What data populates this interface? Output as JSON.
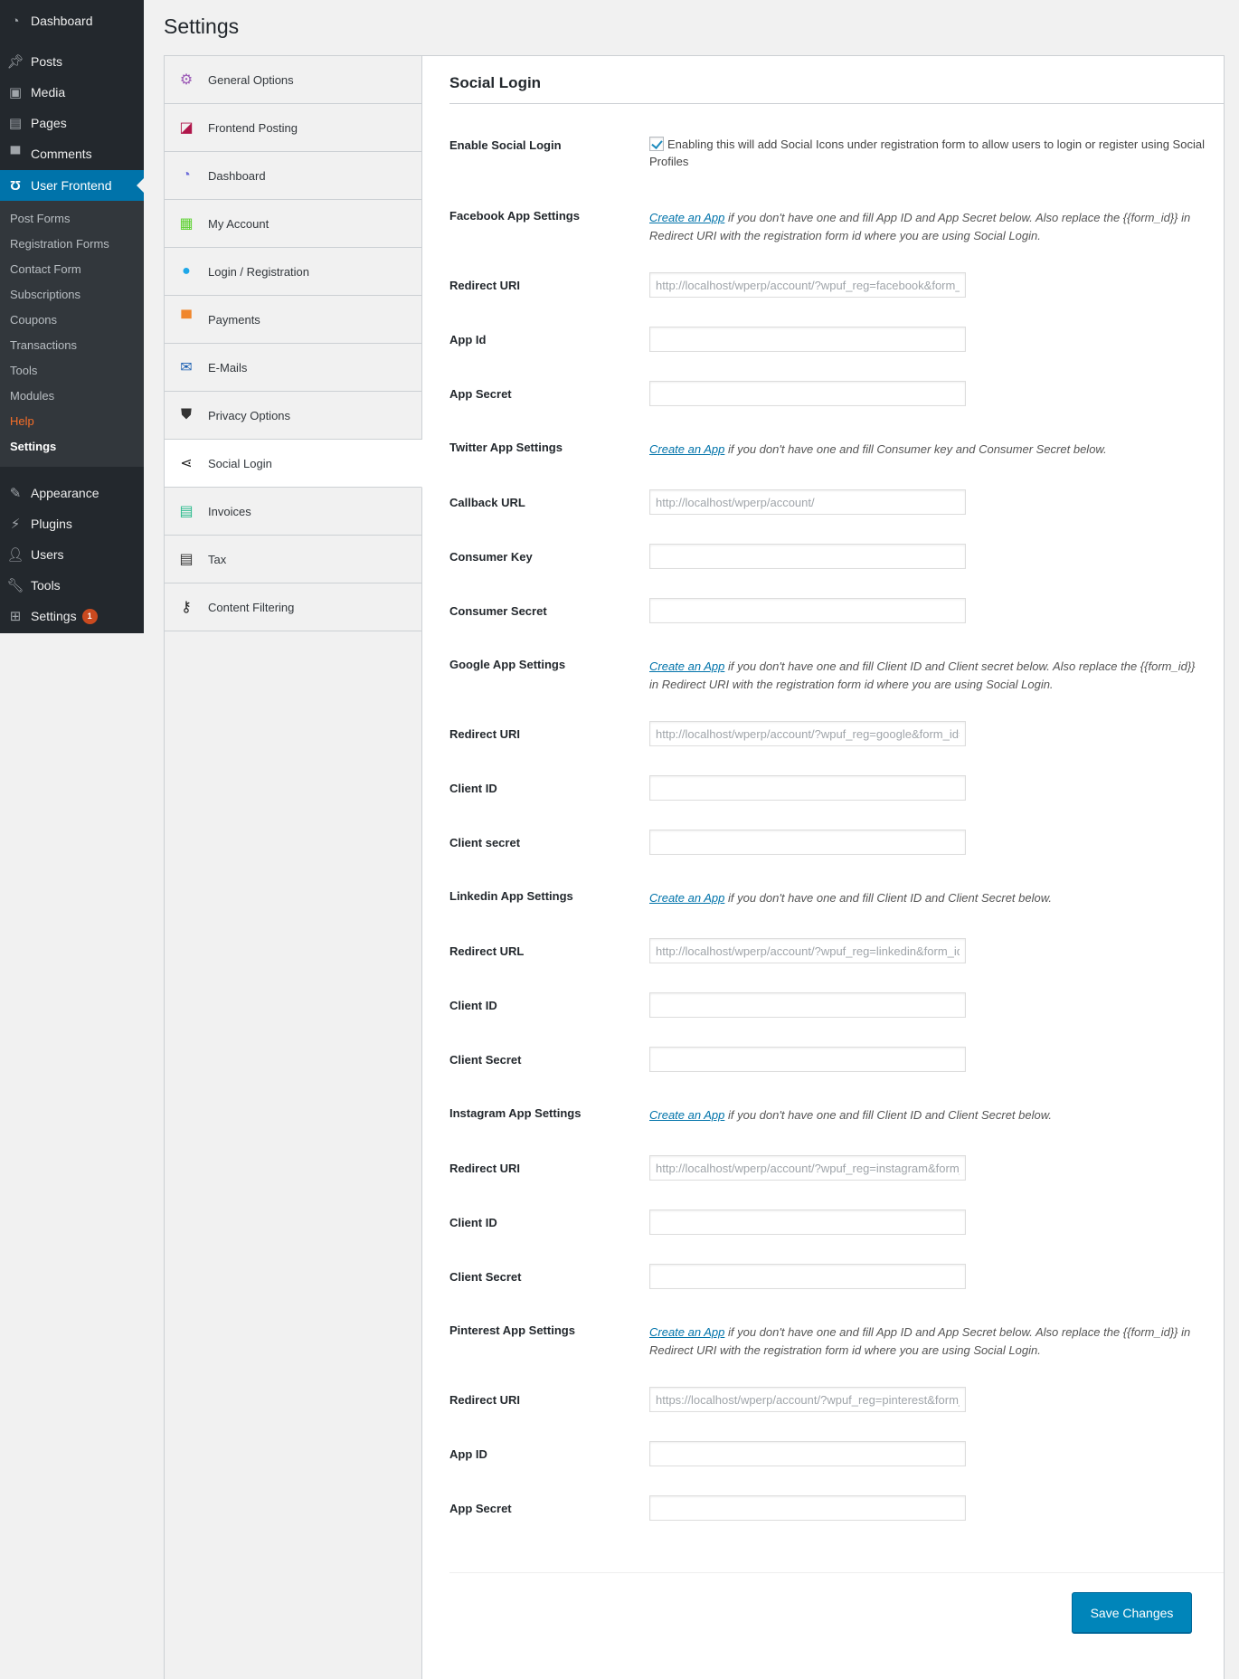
{
  "admin_menu": {
    "items_top": [
      {
        "label": "Dashboard",
        "icon": "dashboard-icon"
      }
    ],
    "items_content": [
      {
        "label": "Posts",
        "icon": "pin-icon"
      },
      {
        "label": "Media",
        "icon": "media-icon"
      },
      {
        "label": "Pages",
        "icon": "pages-icon"
      },
      {
        "label": "Comments",
        "icon": "comment-icon"
      }
    ],
    "current": {
      "label": "User Frontend",
      "icon": "user-frontend-icon"
    },
    "submenu": [
      "Post Forms",
      "Registration Forms",
      "Contact Form",
      "Subscriptions",
      "Coupons",
      "Transactions",
      "Tools",
      "Modules",
      "Help",
      "Settings"
    ],
    "items_bottom": [
      {
        "label": "Appearance",
        "icon": "paintbrush-icon"
      },
      {
        "label": "Plugins",
        "icon": "plugin-icon"
      },
      {
        "label": "Users",
        "icon": "users-icon"
      },
      {
        "label": "Tools",
        "icon": "wrench-icon"
      },
      {
        "label": "Settings",
        "icon": "settings-icon",
        "badge": "1"
      }
    ]
  },
  "page": {
    "title": "Settings"
  },
  "tabs": [
    {
      "label": "General Options",
      "icon": "gear-icon",
      "color": "#9b59b6"
    },
    {
      "label": "Frontend Posting",
      "icon": "edit-icon",
      "color": "#b0154a"
    },
    {
      "label": "Dashboard",
      "icon": "dashboard-icon",
      "color": "#6c6cd9"
    },
    {
      "label": "My Account",
      "icon": "id-card-icon",
      "color": "#5bd12e"
    },
    {
      "label": "Login / Registration",
      "icon": "user-icon",
      "color": "#1ea7e8"
    },
    {
      "label": "Payments",
      "icon": "payment-icon",
      "color": "#f0862b"
    },
    {
      "label": "E-Mails",
      "icon": "envelope-icon",
      "color": "#1b5fb2"
    },
    {
      "label": "Privacy Options",
      "icon": "shield-icon",
      "color": "#333333"
    },
    {
      "label": "Social Login",
      "icon": "share-icon",
      "color": "#222222",
      "active": true
    },
    {
      "label": "Invoices",
      "icon": "invoice-icon",
      "color": "#26b98a"
    },
    {
      "label": "Tax",
      "icon": "document-icon",
      "color": "#333333"
    },
    {
      "label": "Content Filtering",
      "icon": "key-icon",
      "color": "#222222"
    }
  ],
  "panel": {
    "title": "Social Login",
    "enable": {
      "label": "Enable Social Login",
      "checked": true,
      "text": "Enabling this will add Social Icons under registration form to allow users to login or register using Social Profiles"
    },
    "link_text": "Create an App",
    "sections": [
      {
        "heading": "Facebook App Settings",
        "desc": "if you don't have one and fill App ID and App Secret below. Also replace the {{form_id}} in Redirect URI with the registration form id where you are using Social Login.",
        "fields": [
          {
            "label": "Redirect URI",
            "value": "http://localhost/wperp/account/?wpuf_reg=facebook&form_id={{form_id}}",
            "readonly": true
          },
          {
            "label": "App Id",
            "value": ""
          },
          {
            "label": "App Secret",
            "value": ""
          }
        ]
      },
      {
        "heading": "Twitter App Settings",
        "desc": "if you don't have one and fill Consumer key and Consumer Secret below.",
        "fields": [
          {
            "label": "Callback URL",
            "value": "http://localhost/wperp/account/",
            "readonly": true
          },
          {
            "label": "Consumer Key",
            "value": ""
          },
          {
            "label": "Consumer Secret",
            "value": ""
          }
        ]
      },
      {
        "heading": "Google App Settings",
        "desc": "if you don't have one and fill Client ID and Client secret below. Also replace the {{form_id}} in Redirect URI with the registration form id where you are using Social Login.",
        "fields": [
          {
            "label": "Redirect URI",
            "value": "http://localhost/wperp/account/?wpuf_reg=google&form_id={{form_id}}",
            "readonly": true
          },
          {
            "label": "Client ID",
            "value": ""
          },
          {
            "label": "Client secret",
            "value": ""
          }
        ]
      },
      {
        "heading": "Linkedin App Settings",
        "desc": "if you don't have one and fill Client ID and Client Secret below.",
        "fields": [
          {
            "label": "Redirect URL",
            "value": "http://localhost/wperp/account/?wpuf_reg=linkedin&form_id={{form_id}}",
            "readonly": true
          },
          {
            "label": "Client ID",
            "value": ""
          },
          {
            "label": "Client Secret",
            "value": ""
          }
        ]
      },
      {
        "heading": "Instagram App Settings",
        "desc": "if you don't have one and fill Client ID and Client Secret below.",
        "fields": [
          {
            "label": "Redirect URI",
            "value": "http://localhost/wperp/account/?wpuf_reg=instagram&form_id={{form_id}}",
            "readonly": true
          },
          {
            "label": "Client ID",
            "value": ""
          },
          {
            "label": "Client Secret",
            "value": ""
          }
        ]
      },
      {
        "heading": "Pinterest App Settings",
        "desc": "if you don't have one and fill App ID and App Secret below. Also replace the {{form_id}} in Redirect URI with the registration form id where you are using Social Login.",
        "fields": [
          {
            "label": "Redirect URI",
            "value": "https://localhost/wperp/account/?wpuf_reg=pinterest&form_id={{form_id}}",
            "readonly": true
          },
          {
            "label": "App ID",
            "value": ""
          },
          {
            "label": "App Secret",
            "value": ""
          }
        ]
      }
    ],
    "save_label": "Save Changes"
  }
}
